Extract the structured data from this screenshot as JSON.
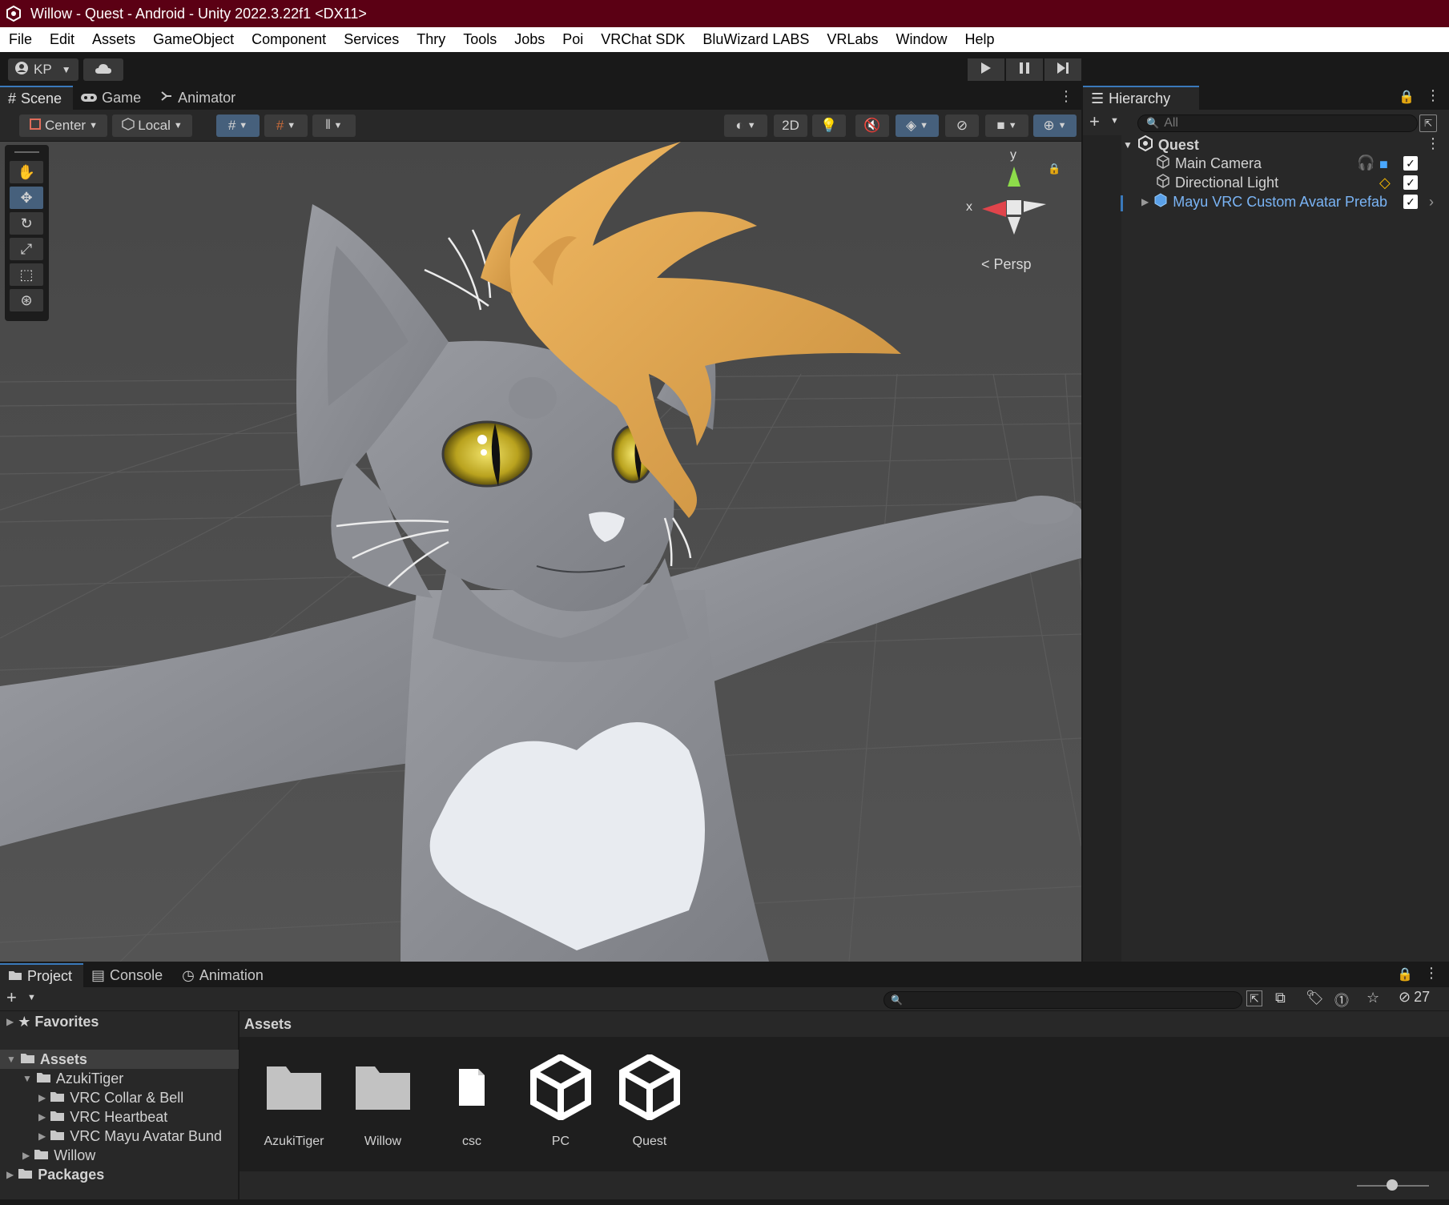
{
  "window": {
    "title": "Willow - Quest - Android - Unity 2022.3.22f1 <DX11>"
  },
  "menu": [
    "File",
    "Edit",
    "Assets",
    "GameObject",
    "Component",
    "Services",
    "Thry",
    "Tools",
    "Jobs",
    "Poi",
    "VRChat SDK",
    "BluWizard LABS",
    "VRLabs",
    "Window",
    "Help"
  ],
  "toolbar": {
    "account_label": "KP"
  },
  "scene_panel": {
    "tabs": [
      "Scene",
      "Game",
      "Animator"
    ],
    "pivot_mode": "Center",
    "pivot_rotation": "Local",
    "mode_2d": "2D",
    "gizmo_x": "x",
    "gizmo_y": "y",
    "projection": "Persp"
  },
  "hierarchy": {
    "tab": "Hierarchy",
    "search_placeholder": "All",
    "scene_name": "Quest",
    "items": [
      {
        "label": "Main Camera"
      },
      {
        "label": "Directional Light"
      },
      {
        "label": "Mayu VRC Custom Avatar Prefab"
      }
    ]
  },
  "bottom_panel": {
    "tabs": [
      "Project",
      "Console",
      "Animation"
    ],
    "hidden_count": "27",
    "tree": {
      "favorites": "Favorites",
      "assets": "Assets",
      "azuki": "AzukiTiger",
      "collar": "VRC Collar & Bell",
      "heartbeat": "VRC Heartbeat",
      "mayu": "VRC Mayu Avatar Bund",
      "willow": "Willow",
      "packages": "Packages"
    },
    "breadcrumb": "Assets",
    "assets": [
      {
        "label": "AzukiTiger",
        "icon": "folder-icon"
      },
      {
        "label": "Willow",
        "icon": "folder-icon"
      },
      {
        "label": "csc",
        "icon": "file-icon"
      },
      {
        "label": "PC",
        "icon": "unity-scene-icon"
      },
      {
        "label": "Quest",
        "icon": "unity-scene-icon"
      }
    ]
  },
  "colors": {
    "title_bar": "#5b0014",
    "accent": "#3a79bb",
    "hair": "#e2a550",
    "fur": "#8e9096",
    "prefab_text": "#7ab4f5"
  }
}
